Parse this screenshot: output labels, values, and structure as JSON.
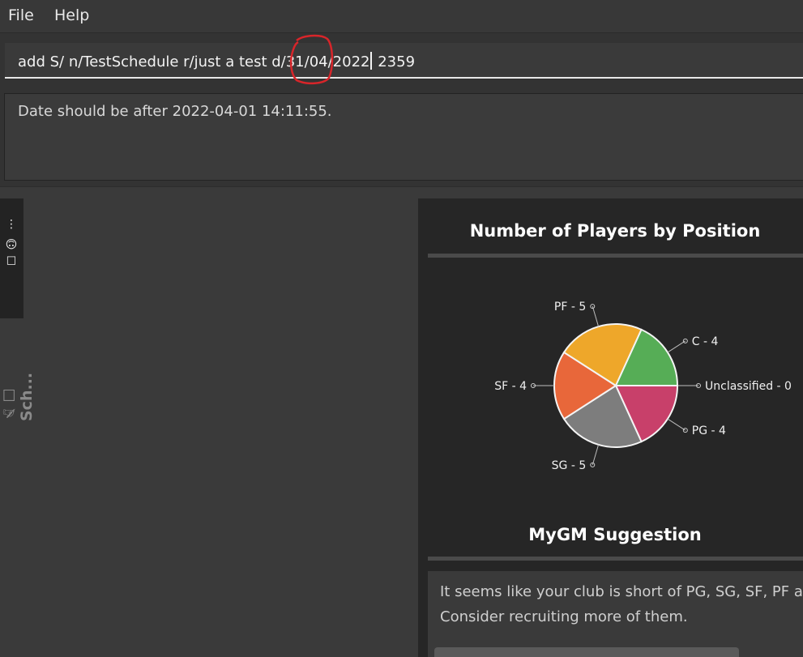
{
  "menu": {
    "file": "File",
    "help": "Help"
  },
  "command": {
    "before_cursor": "add S/ n/TestSchedule r/just a test d/31/04/2022",
    "after_cursor": " 2359"
  },
  "result": {
    "message": "Date should be after 2022-04-01 14:11:55."
  },
  "sidebar": {
    "more_icon": "⋮",
    "icons": "☐ ☺",
    "schedule_label": "✍☐ Sch..."
  },
  "stats_panel": {
    "title": "Number of Players by Position",
    "suggestion_title": "MyGM Suggestion",
    "suggestion_line1": "It seems like your club is short of PG, SG, SF, PF and C",
    "suggestion_line2": "Consider recruiting more of them."
  },
  "chart_data": {
    "type": "pie",
    "title": "Number of Players by Position",
    "slices": [
      {
        "label": "Unclassified - 0",
        "name": "Unclassified",
        "value": 0,
        "color": "#b0b0b0"
      },
      {
        "label": "PG - 4",
        "name": "PG",
        "value": 4,
        "color": "#c8406a"
      },
      {
        "label": "SG - 5",
        "name": "SG",
        "value": 5,
        "color": "#7d7d7d"
      },
      {
        "label": "SF - 4",
        "name": "SF",
        "value": 4,
        "color": "#e8673a"
      },
      {
        "label": "PF - 5",
        "name": "PF",
        "value": 5,
        "color": "#eea72a"
      },
      {
        "label": "C - 4",
        "name": "C",
        "value": 4,
        "color": "#56ad56"
      }
    ]
  }
}
